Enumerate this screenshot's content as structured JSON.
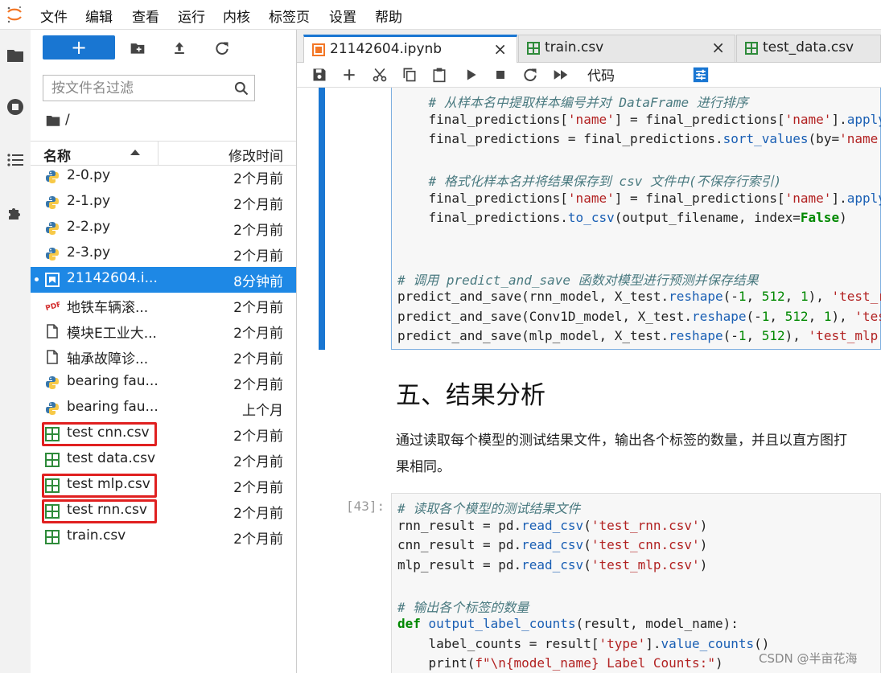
{
  "menu": [
    "文件",
    "编辑",
    "查看",
    "运行",
    "内核",
    "标签页",
    "设置",
    "帮助"
  ],
  "filebrowser": {
    "new_label": "+",
    "filter_placeholder": "按文件名过滤",
    "breadcrumb": "/",
    "col_name": "名称",
    "col_modified": "修改时间",
    "files": [
      {
        "name": "2-0.py",
        "modified": "2个月前",
        "type": "python"
      },
      {
        "name": "2-1.py",
        "modified": "2个月前",
        "type": "python"
      },
      {
        "name": "2-2.py",
        "modified": "2个月前",
        "type": "python"
      },
      {
        "name": "2-3.py",
        "modified": "2个月前",
        "type": "python"
      },
      {
        "name": "21142604.i...",
        "modified": "8分钟前",
        "type": "notebook",
        "selected": true
      },
      {
        "name": "地铁车辆滚...",
        "modified": "2个月前",
        "type": "pdf"
      },
      {
        "name": "模块E工业大...",
        "modified": "2个月前",
        "type": "file"
      },
      {
        "name": "轴承故障诊...",
        "modified": "2个月前",
        "type": "file"
      },
      {
        "name": "bearing fau...",
        "modified": "2个月前",
        "type": "python"
      },
      {
        "name": "bearing fau...",
        "modified": "上个月",
        "type": "python"
      },
      {
        "name": "test cnn.csv",
        "modified": "2个月前",
        "type": "csv",
        "highlighted": true
      },
      {
        "name": "test data.csv",
        "modified": "2个月前",
        "type": "csv"
      },
      {
        "name": "test mlp.csv",
        "modified": "2个月前",
        "type": "csv",
        "highlighted": true
      },
      {
        "name": "test rnn.csv",
        "modified": "2个月前",
        "type": "csv",
        "highlighted": true
      },
      {
        "name": "train.csv",
        "modified": "2个月前",
        "type": "csv"
      }
    ]
  },
  "tabs": [
    {
      "label": "21142604.ipynb",
      "icon": "notebook-icon",
      "close": "×",
      "active": true
    },
    {
      "label": "train.csv",
      "icon": "csv-icon",
      "close": "×",
      "active": false
    },
    {
      "label": "test_data.csv",
      "icon": "csv-icon",
      "close": "",
      "active": false
    }
  ],
  "toolbar": {
    "cell_type": "代码"
  },
  "cells": {
    "prev_code_lines": [
      "    # 从样本名中提取样本编号并对 DataFrame 进行排序",
      "    final_predictions['name'] = final_predictions['name'].apply",
      "    final_predictions = final_predictions.sort_values(by='name'",
      "",
      "    # 格式化样本名并将结果保存到 csv 文件中(不保存行索引)",
      "    final_predictions['name'] = final_predictions['name'].apply",
      "    final_predictions.to_csv(output_filename, index=False)",
      "",
      "",
      "# 调用 predict_and_save 函数对模型进行预测并保存结果",
      "predict_and_save(rnn_model, X_test.reshape(-1, 512, 1), 'test_r",
      "predict_and_save(Conv1D_model, X_test.reshape(-1, 512, 1), 'tes",
      "predict_and_save(mlp_model, X_test.reshape(-1, 512), 'test_mlp."
    ],
    "md_heading": "五、结果分析",
    "md_paragraph_1": "通过读取每个模型的测试结果文件，输出各个标签的数量，并且以直方图打",
    "md_paragraph_2": "果相同。",
    "prompt": "[43]:",
    "code_lines": [
      "# 读取各个模型的测试结果文件",
      "rnn_result = pd.read_csv('test_rnn.csv')",
      "cnn_result = pd.read_csv('test_cnn.csv')",
      "mlp_result = pd.read_csv('test_mlp.csv')",
      "",
      "# 输出各个标签的数量",
      "def output_label_counts(result, model_name):",
      "    label_counts = result['type'].value_counts()",
      "    print(f\"\\n{model_name} Label Counts:\")"
    ]
  },
  "watermark": "CSDN @半亩花海"
}
